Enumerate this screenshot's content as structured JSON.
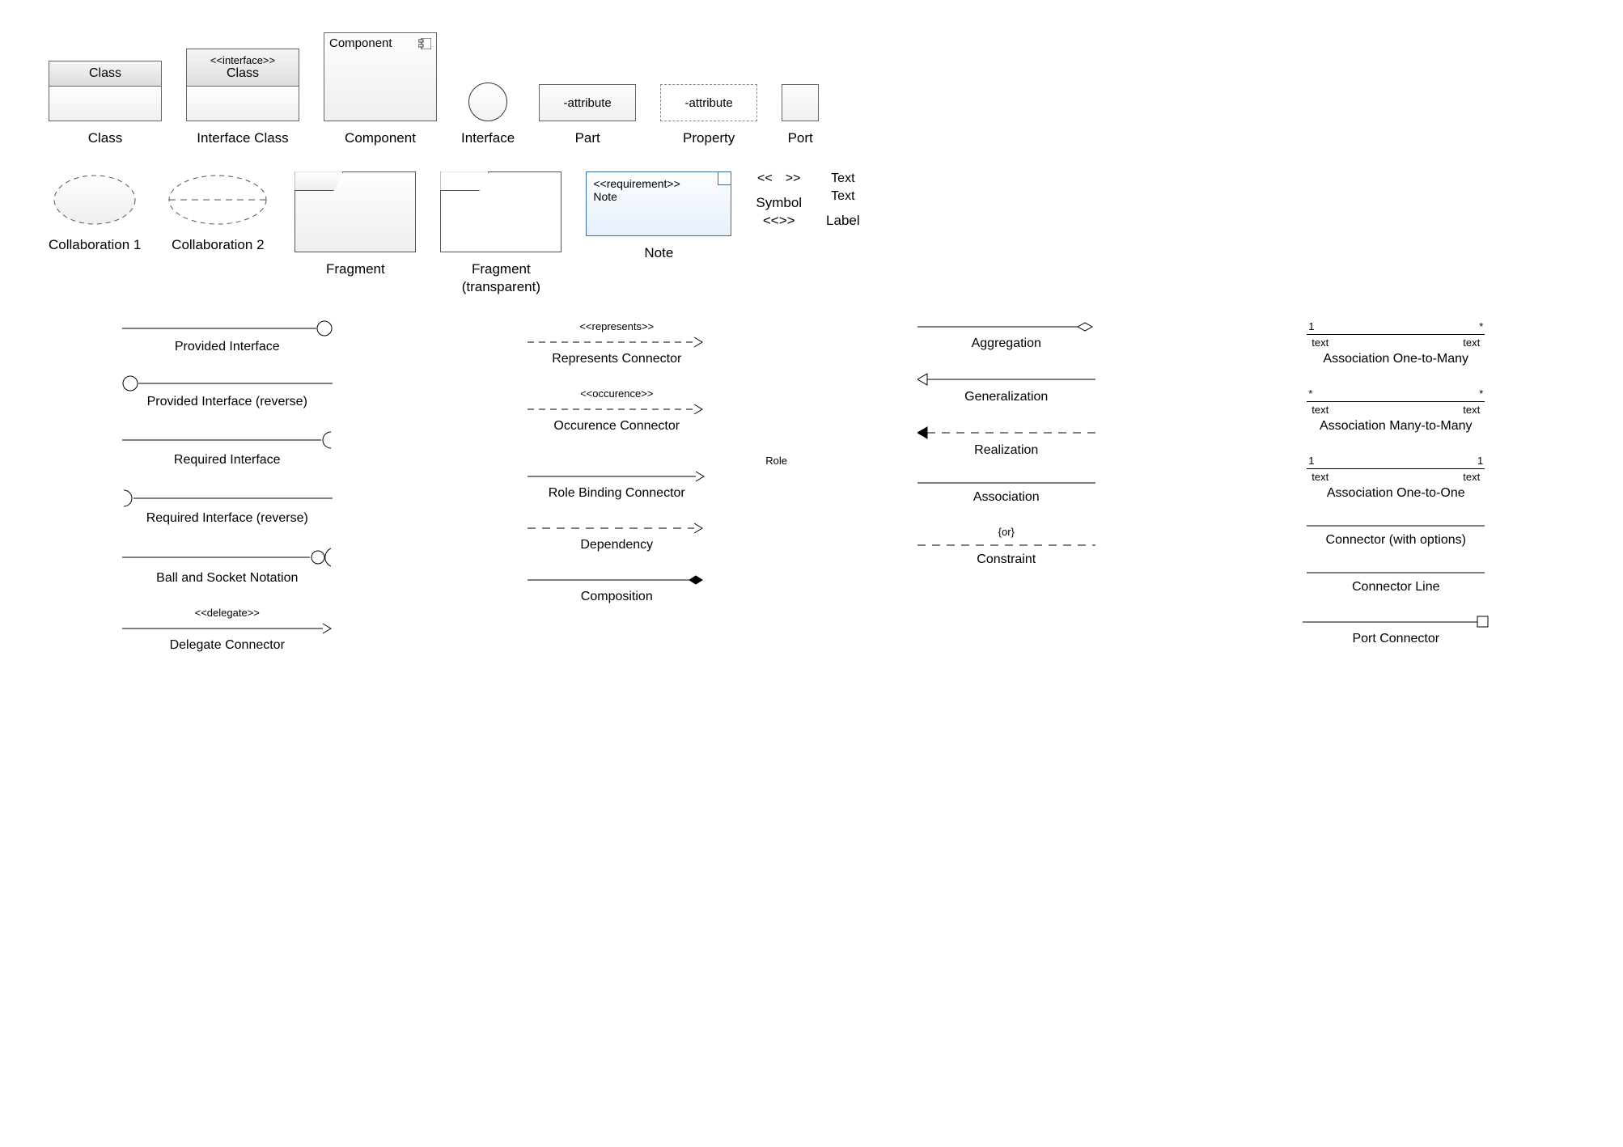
{
  "row1": {
    "class": {
      "header": "Class",
      "caption": "Class"
    },
    "interfaceClass": {
      "stereo": "<<interface>>",
      "name": "Class",
      "caption": "Interface Class"
    },
    "component": {
      "label": "Component",
      "caption": "Component"
    },
    "interface": {
      "caption": "Interface"
    },
    "part": {
      "text": "-attribute",
      "caption": "Part"
    },
    "property": {
      "text": "-attribute",
      "caption": "Property"
    },
    "port": {
      "caption": "Port"
    }
  },
  "row2": {
    "collab1": "Collaboration 1",
    "collab2": "Collaboration 2",
    "fragment": "Fragment",
    "fragmentT": "Fragment\n(transparent)",
    "note": {
      "stereo": "<<requirement>>",
      "text": "Note",
      "caption": "Note"
    },
    "symbol": {
      "left": "<<",
      "right": ">>",
      "caption": "Symbol\n<<>>"
    },
    "textLabel": {
      "t1": "Text",
      "t2": "Text",
      "caption": "Label"
    }
  },
  "col1": {
    "providedInterface": "Provided Interface",
    "providedInterfaceRev": "Provided Interface (reverse)",
    "requiredInterface": "Required Interface",
    "requiredInterfaceRev": "Required Interface (reverse)",
    "ballSocket": "Ball and Socket Notation",
    "delegate": {
      "stereo": "<<delegate>>",
      "caption": "Delegate Connector"
    }
  },
  "col2": {
    "represents": {
      "stereo": "<<represents>>",
      "caption": "Represents Connector"
    },
    "occurence": {
      "stereo": "<<occurence>>",
      "caption": "Occurence Connector"
    },
    "roleBinding": {
      "role": "Role",
      "caption": "Role Binding Connector"
    },
    "dependency": "Dependency",
    "composition": "Composition"
  },
  "col3": {
    "aggregation": "Aggregation",
    "generalization": "Generalization",
    "realization": "Realization",
    "association": "Association",
    "constraint": {
      "cond": "{or}",
      "caption": "Constraint"
    }
  },
  "col4": {
    "assoc1M": {
      "l": "1",
      "r": "*",
      "tl": "text",
      "tr": "text",
      "caption": "Association One-to-Many"
    },
    "assocMM": {
      "l": "*",
      "r": "*",
      "tl": "text",
      "tr": "text",
      "caption": "Association Many-to-Many"
    },
    "assoc11": {
      "l": "1",
      "r": "1",
      "tl": "text",
      "tr": "text",
      "caption": "Association One-to-One"
    },
    "connectorOpts": "Connector (with options)",
    "connectorLine": "Connector Line",
    "portConnector": "Port Connector"
  }
}
